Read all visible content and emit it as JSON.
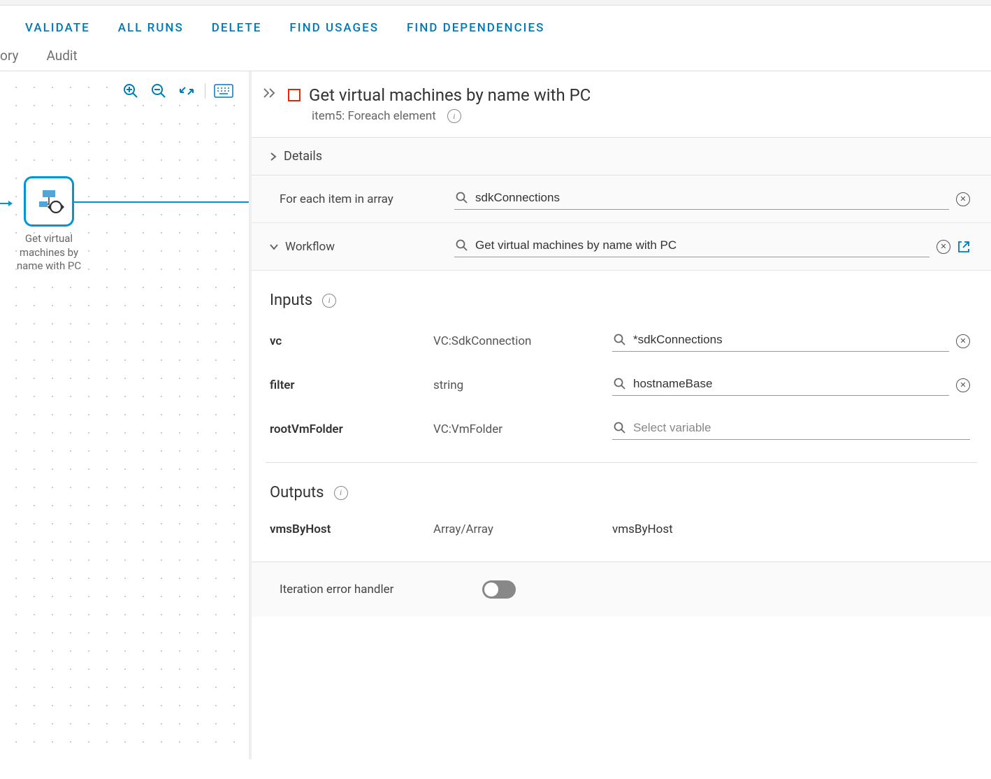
{
  "actions": {
    "validate": "VALIDATE",
    "all_runs": "ALL RUNS",
    "delete": "DELETE",
    "find_usages": "FIND USAGES",
    "find_deps": "FIND DEPENDENCIES"
  },
  "tabs": {
    "history": "ory",
    "audit": "Audit"
  },
  "node": {
    "label": "Get virtual machines by name with PC"
  },
  "panel": {
    "title": "Get virtual machines by name with PC",
    "subtitle": "item5: Foreach element"
  },
  "sections": {
    "details": "Details",
    "workflow": "Workflow",
    "inputs": "Inputs",
    "outputs": "Outputs"
  },
  "fields": {
    "foreach_label": "For each item in array",
    "foreach_value": "sdkConnections",
    "workflow_value": "Get virtual machines by name with PC"
  },
  "inputs": [
    {
      "name": "vc",
      "type": "VC:SdkConnection",
      "value": "*sdkConnections",
      "has_clear": true
    },
    {
      "name": "filter",
      "type": "string",
      "value": "hostnameBase",
      "has_clear": true
    },
    {
      "name": "rootVmFolder",
      "type": "VC:VmFolder",
      "value": "",
      "placeholder": "Select variable",
      "has_clear": false
    }
  ],
  "outputs": [
    {
      "name": "vmsByHost",
      "type": "Array/Array",
      "value": "vmsByHost"
    }
  ],
  "toggle": {
    "label": "Iteration error handler",
    "on": false
  }
}
